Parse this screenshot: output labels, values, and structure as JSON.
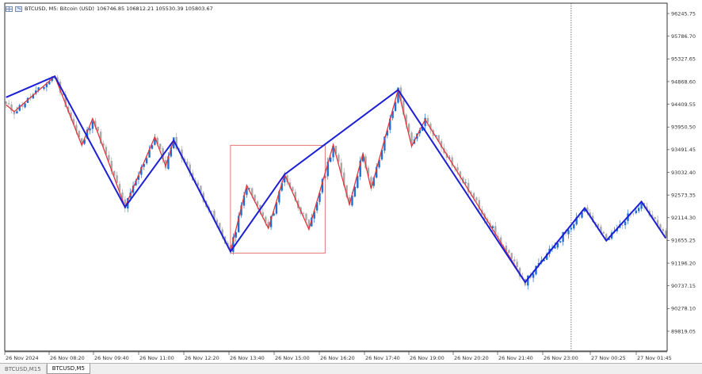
{
  "header": {
    "symbol_info": "BTCUSD, M5:  Bitcoin (USD)",
    "ohlc": "106746.85 106812.21 105530.39 105803.67",
    "icons": [
      "chart-grid-icon",
      "zoom-icon"
    ]
  },
  "tabs": [
    {
      "label": "BTCUSD,M15",
      "active": false
    },
    {
      "label": "BTCUSD,M5",
      "active": true
    }
  ],
  "colors": {
    "bull": "#1f6fd1",
    "bear": "#a9a9a9",
    "zigzag_major": "#1c1fd6",
    "zigzag_minor": "#e0373d",
    "box": "#e06868",
    "axis": "#333333",
    "grid": "#000000"
  },
  "chart_data": {
    "type": "candlestick",
    "y_ticks": [
      "96245.75",
      "95786.70",
      "95327.65",
      "94868.60",
      "94409.55",
      "93950.50",
      "93491.45",
      "93032.40",
      "92573.35",
      "92114.30",
      "91655.25",
      "91196.20",
      "90737.15",
      "90278.10",
      "89819.05"
    ],
    "x_ticks": [
      "26 Nov 2024",
      "26 Nov 08:20",
      "26 Nov 09:40",
      "26 Nov 11:00",
      "26 Nov 12:20",
      "26 Nov 13:40",
      "26 Nov 15:00",
      "26 Nov 16:20",
      "26 Nov 17:40",
      "26 Nov 19:00",
      "26 Nov 20:20",
      "26 Nov 21:40",
      "26 Nov 23:00",
      "27 Nov 00:25",
      "27 Nov 01:45"
    ],
    "ylim": [
      89600,
      96400
    ],
    "x_count": 245,
    "period_separator_index": 209,
    "major_zigzag": [
      {
        "i": 0,
        "p": 94550
      },
      {
        "i": 18,
        "p": 94975
      },
      {
        "i": 44,
        "p": 92330
      },
      {
        "i": 62,
        "p": 93680
      },
      {
        "i": 83,
        "p": 91430
      },
      {
        "i": 103,
        "p": 92990
      },
      {
        "i": 145,
        "p": 94700
      },
      {
        "i": 192,
        "p": 90810
      },
      {
        "i": 214,
        "p": 92310
      },
      {
        "i": 222,
        "p": 91650
      },
      {
        "i": 235,
        "p": 92440
      },
      {
        "i": 244,
        "p": 91700
      }
    ],
    "minor_zigzag": [
      {
        "i": 0,
        "p": 94400
      },
      {
        "i": 3,
        "p": 94260
      },
      {
        "i": 18,
        "p": 94975
      },
      {
        "i": 28,
        "p": 93580
      },
      {
        "i": 32,
        "p": 94120
      },
      {
        "i": 44,
        "p": 92330
      },
      {
        "i": 55,
        "p": 93750
      },
      {
        "i": 59,
        "p": 93160
      },
      {
        "i": 62,
        "p": 93680
      },
      {
        "i": 83,
        "p": 91430
      },
      {
        "i": 89,
        "p": 92770
      },
      {
        "i": 97,
        "p": 91900
      },
      {
        "i": 103,
        "p": 92990
      },
      {
        "i": 112,
        "p": 91880
      },
      {
        "i": 121,
        "p": 93590
      },
      {
        "i": 127,
        "p": 92380
      },
      {
        "i": 132,
        "p": 93420
      },
      {
        "i": 135,
        "p": 92700
      },
      {
        "i": 145,
        "p": 94700
      },
      {
        "i": 150,
        "p": 93560
      },
      {
        "i": 155,
        "p": 94100
      },
      {
        "i": 192,
        "p": 90810
      },
      {
        "i": 214,
        "p": 92310
      },
      {
        "i": 222,
        "p": 91650
      },
      {
        "i": 235,
        "p": 92440
      },
      {
        "i": 244,
        "p": 91700
      }
    ],
    "annotation_box": {
      "i1": 83,
      "i2": 118,
      "p1": 93580,
      "p2": 91400
    },
    "candle_seed": 11
  }
}
